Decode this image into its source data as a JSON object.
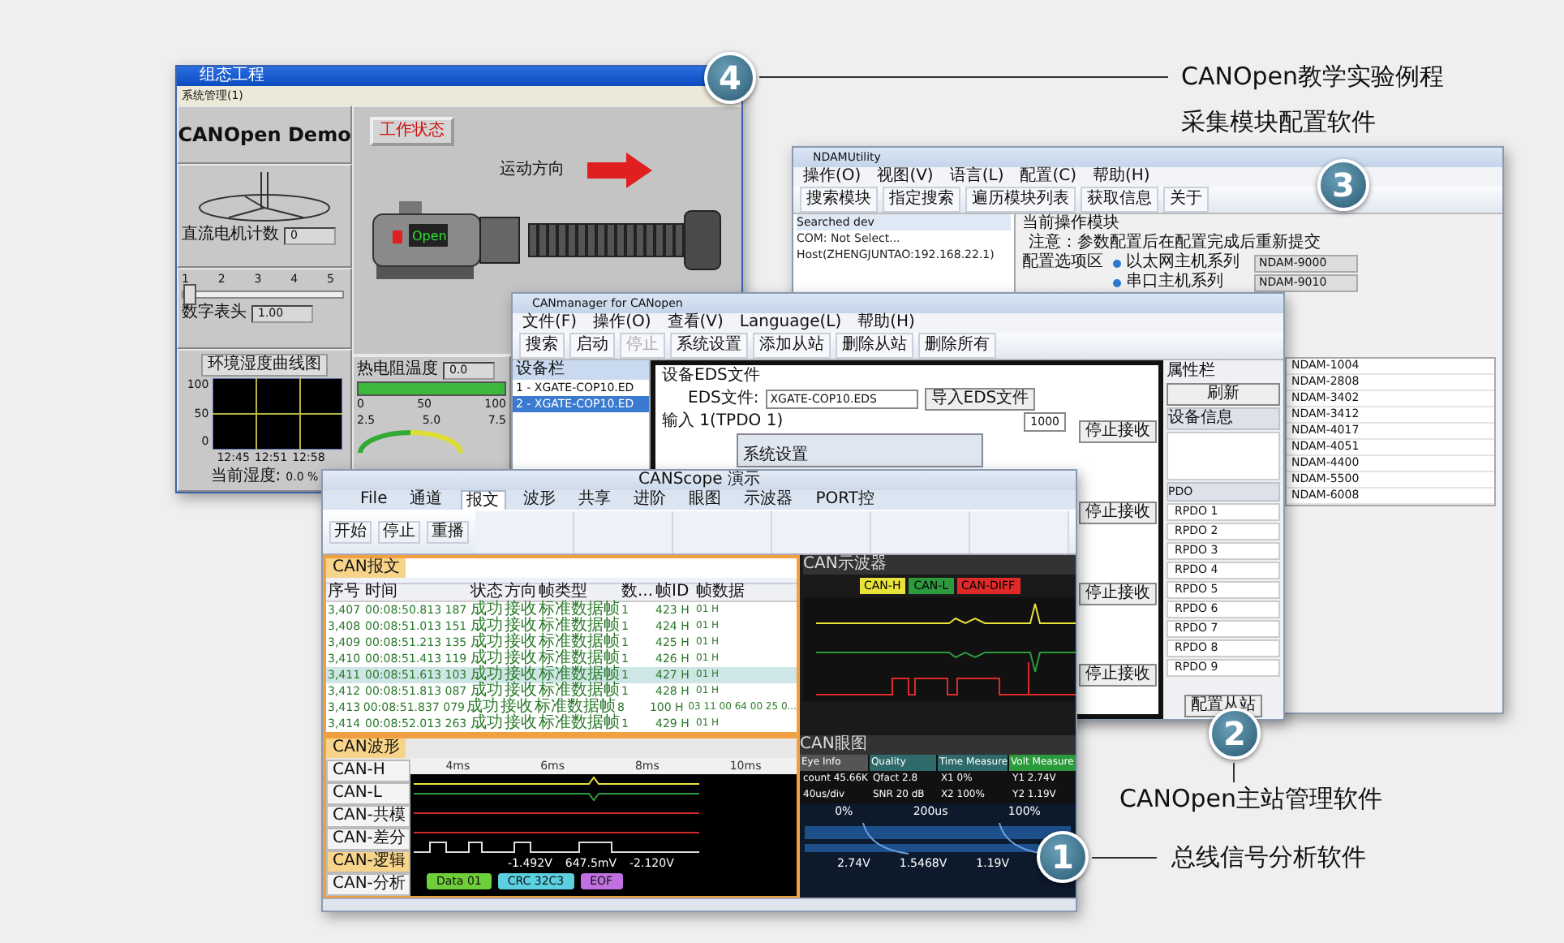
{
  "callouts": [
    {
      "number": "4",
      "label": "CANOpen教学实验例程"
    },
    {
      "number": "3",
      "label": "采集模块配置软件"
    },
    {
      "number": "2",
      "label": "CANOpen主站管理软件"
    },
    {
      "number": "1",
      "label": "总线信号分析软件"
    }
  ],
  "hmi_window": {
    "title": "组态工程",
    "menu": [
      "系统管理(1)"
    ],
    "heading": "CANOpen Demo",
    "motor_counter": {
      "label": "直流电机计数",
      "value": "0"
    },
    "slider": {
      "ticks": [
        "1",
        "2",
        "3",
        "4",
        "5"
      ],
      "level": 0
    },
    "meter": {
      "label": "数字表头",
      "value": "1.00"
    },
    "humidity_chart": {
      "title": "环境湿度曲线图",
      "y_ticks": [
        "100",
        "50",
        "0"
      ],
      "x_ticks": [
        "12:45",
        "12:51",
        "12:58"
      ]
    },
    "humidity": {
      "label": "当前湿度:",
      "value": "0.0 %"
    },
    "status_button": "工作状态",
    "direction_label": "运动方向",
    "motor_label": "Open",
    "temperature": {
      "label": "热电阻温度",
      "value": "0.0",
      "scale": [
        "0",
        "50",
        "100"
      ],
      "gauge_ticks": [
        "2.5",
        "5.0",
        "7.5"
      ]
    }
  },
  "ndam_window": {
    "title": "NDAMUtility",
    "menu": [
      "操作(O)",
      "视图(V)",
      "语言(L)",
      "配置(C)",
      "帮助(H)"
    ],
    "toolbar": [
      "搜索模块",
      "指定搜索",
      "遍历模块列表",
      "获取信息",
      "关于"
    ],
    "tree": {
      "title": "Searched dev",
      "items": [
        "COM: Not Select...",
        "Host(ZHENGJUNTAO:192.168.22.1)"
      ]
    },
    "config": {
      "current_label": "当前操作模块",
      "note": "注意：参数配置后在配置完成后重新提交",
      "options_label": "配置选项区",
      "groups": [
        {
          "label": "以太网主机系列",
          "model": "NDAM-9000"
        },
        {
          "label": "串口主机系列",
          "model": "NDAM-9010"
        }
      ]
    },
    "module_list": [
      "NDAM-1004",
      "NDAM-2808",
      "NDAM-3402",
      "NDAM-3412",
      "NDAM-4017",
      "NDAM-4051",
      "NDAM-4400",
      "NDAM-5500",
      "NDAM-6008"
    ]
  },
  "canmanager_window": {
    "title": "CANmanager for CANopen",
    "menu": [
      "文件(F)",
      "操作(O)",
      "查看(V)",
      "Language(L)",
      "帮助(H)"
    ],
    "toolbar": [
      {
        "label": "搜索",
        "disabled": false
      },
      {
        "label": "启动",
        "disabled": false
      },
      {
        "label": "停止",
        "disabled": true
      },
      {
        "label": "系统设置",
        "disabled": false
      },
      {
        "label": "添加从站",
        "disabled": false
      },
      {
        "label": "删除从站",
        "disabled": false
      },
      {
        "label": "删除所有",
        "disabled": false
      }
    ],
    "device_tree": {
      "title": "设备栏",
      "items": [
        {
          "label": "1 - XGATE-COP10.ED",
          "selected": false
        },
        {
          "label": "2 - XGATE-COP10.ED",
          "selected": true
        }
      ]
    },
    "eds": {
      "title": "设备EDS文件",
      "file_label": "EDS文件:",
      "file_value": "XGATE-COP10.EDS",
      "import_button": "导入EDS文件"
    },
    "input_label": "输入 1(TPDO 1)",
    "settings_dialog": {
      "title": "系统设置"
    },
    "interval_value": "1000",
    "stop_buttons": [
      "停止接收",
      "停止接收",
      "停止接收",
      "停止接收"
    ],
    "properties": {
      "title": "属性栏",
      "refresh_button": "刷新",
      "section": "设备信息",
      "pdo_title": "PDO",
      "pdo_items": [
        "RPDO 1",
        "RPDO 2",
        "RPDO 3",
        "RPDO 4",
        "RPDO 5",
        "RPDO 6",
        "RPDO 7",
        "RPDO 8",
        "RPDO 9"
      ],
      "configure_button": "配置从站"
    }
  },
  "canscope_window": {
    "title": "CANScope 演示",
    "tabs": [
      {
        "label": "File",
        "selected": false
      },
      {
        "label": "通道",
        "selected": false
      },
      {
        "label": "报文",
        "selected": true
      },
      {
        "label": "波形",
        "selected": false
      },
      {
        "label": "共享",
        "selected": false
      },
      {
        "label": "进阶",
        "selected": false
      },
      {
        "label": "眼图",
        "selected": false
      },
      {
        "label": "示波器",
        "selected": false
      },
      {
        "label": "PORT控",
        "selected": false
      }
    ],
    "ribbon_buttons": [
      "开始",
      "停止",
      "重播"
    ],
    "messages": {
      "tab": "CAN报文",
      "columns": [
        "序号",
        "时间",
        "状态",
        "方向",
        "帧类型",
        "数...",
        "帧ID",
        "帧数据"
      ],
      "rows": [
        {
          "cells": [
            "3,407",
            "00:08:50.813 187",
            "成功",
            "接收",
            "标准数据帧",
            "1",
            "423 H",
            "01 H"
          ],
          "selected": false
        },
        {
          "cells": [
            "3,408",
            "00:08:51.013 151",
            "成功",
            "接收",
            "标准数据帧",
            "1",
            "424 H",
            "01 H"
          ],
          "selected": false
        },
        {
          "cells": [
            "3,409",
            "00:08:51.213 135",
            "成功",
            "接收",
            "标准数据帧",
            "1",
            "425 H",
            "01 H"
          ],
          "selected": false
        },
        {
          "cells": [
            "3,410",
            "00:08:51.413 119",
            "成功",
            "接收",
            "标准数据帧",
            "1",
            "426 H",
            "01 H"
          ],
          "selected": false
        },
        {
          "cells": [
            "3,411",
            "00:08:51.613 103",
            "成功",
            "接收",
            "标准数据帧",
            "1",
            "427 H",
            "01 H"
          ],
          "selected": true
        },
        {
          "cells": [
            "3,412",
            "00:08:51.813 087",
            "成功",
            "接收",
            "标准数据帧",
            "1",
            "428 H",
            "01 H"
          ],
          "selected": false
        },
        {
          "cells": [
            "3,413",
            "00:08:51.837 079",
            "成功",
            "接收",
            "标准数据帧",
            "8",
            "100 H",
            "03 11 00 64 00 25 0..."
          ],
          "selected": false
        },
        {
          "cells": [
            "3,414",
            "00:08:52.013 263",
            "成功",
            "接收",
            "标准数据帧",
            "1",
            "429 H",
            "01 H"
          ],
          "selected": false
        }
      ]
    },
    "scope": {
      "title": "CAN示波器",
      "channels": [
        {
          "name": "CAN-H",
          "color": "#e8e23a"
        },
        {
          "name": "CAN-L",
          "color": "#2e9a3e"
        },
        {
          "name": "CAN-DIFF",
          "color": "#e02a2a"
        }
      ]
    },
    "waveform": {
      "tab": "CAN波形",
      "channels": [
        {
          "name": "CAN-H",
          "selected": false
        },
        {
          "name": "CAN-L",
          "selected": false
        },
        {
          "name": "CAN-共模",
          "selected": false
        },
        {
          "name": "CAN-差分",
          "selected": false
        },
        {
          "name": "CAN-逻辑",
          "selected": true
        },
        {
          "name": "CAN-分析",
          "selected": false
        }
      ],
      "time_ticks": [
        "4ms",
        "6ms",
        "8ms",
        "10ms"
      ],
      "readings": [
        "-1.492V",
        "647.5mV",
        "-2.120V"
      ],
      "segments": [
        {
          "label": "Data 01",
          "color": "#6fcf3a"
        },
        {
          "label": "CRC 32C3",
          "color": "#5ad0e0"
        },
        {
          "label": "EOF",
          "color": "#c070e0"
        }
      ]
    },
    "eye": {
      "title": "CAN眼图",
      "headers": [
        "Eye Info",
        "Quality",
        "Time Measure",
        "Volt Measure"
      ],
      "metrics": [
        [
          "count 45.66K",
          "40us/div"
        ],
        [
          "Qfact 2.8",
          "SNR 20 dB"
        ],
        [
          "X1 0%",
          "X2 100%"
        ],
        [
          "Y1 2.74V",
          "Y2 1.19V"
        ]
      ],
      "plot_labels": [
        "0%",
        "200us",
        "100%",
        "2.74V",
        "1.5468V",
        "1.19V"
      ]
    }
  }
}
